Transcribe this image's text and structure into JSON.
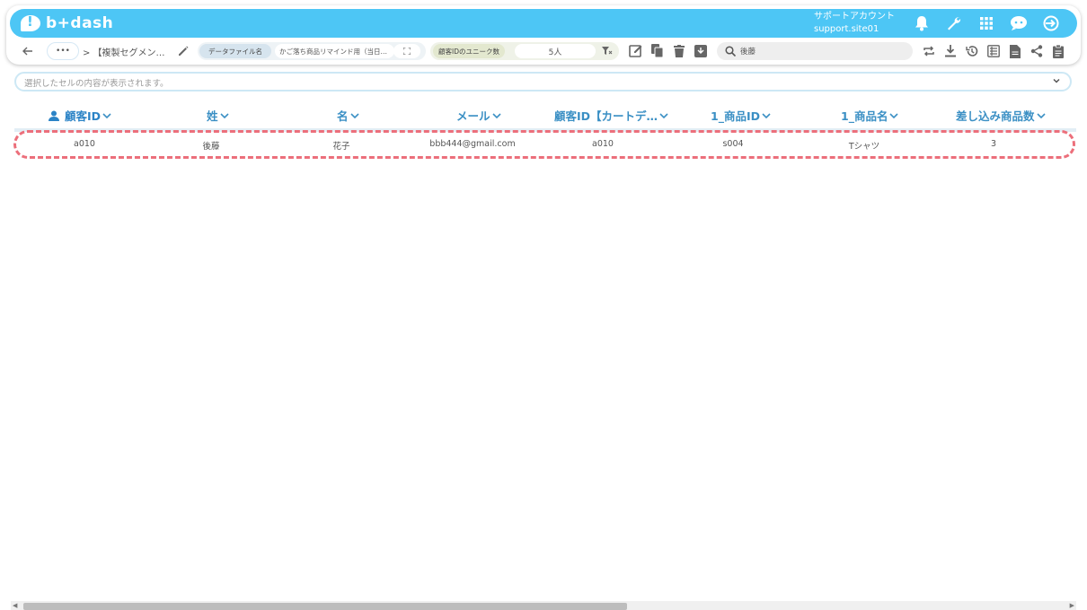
{
  "app": {
    "logo_text": "b+dash",
    "account_name": "サポートアカウント",
    "account_id": "support.site01"
  },
  "toolbar": {
    "ellipsis": "•••",
    "breadcrumb": "> 【複製セグメン…",
    "data_file_label": "データファイル名",
    "data_file_value": "かご落ち商品リマインド用（当日…",
    "unique_label": "顧客IDのユニーク数",
    "unique_value": "5人",
    "search_value": "後藤"
  },
  "cell_info": {
    "placeholder": "選択したセルの内容が表示されます。"
  },
  "table": {
    "columns": [
      "顧客ID",
      "姓",
      "名",
      "メール",
      "顧客ID【カートデ…",
      "1_商品ID",
      "1_商品名",
      "差し込み商品数"
    ],
    "rows": [
      [
        "a010",
        "後藤",
        "花子",
        "bbb444@gmail.com",
        "a010",
        "s004",
        "Tシャツ",
        "3"
      ]
    ]
  },
  "colors": {
    "brand": "#4dc6f5",
    "header_text": "#3a8fc4",
    "highlight": "#ec6f7b"
  }
}
